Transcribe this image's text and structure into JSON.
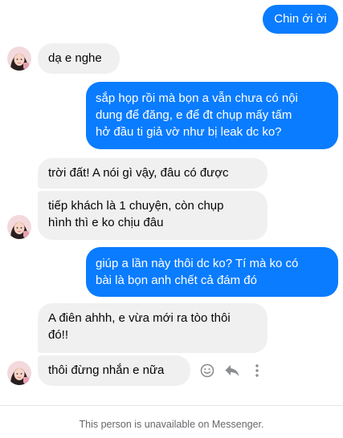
{
  "messages": [
    {
      "side": "out",
      "text": "Chin ới ời"
    },
    {
      "side": "in",
      "text": "dạ e nghe"
    },
    {
      "side": "out",
      "text": "sắp họp rồi mà bọn a vẫn chưa có nội\ndung để đăng, e để đt chụp mấy tấm\nhở đầu ti giả vờ như bị leak dc ko?"
    },
    {
      "side": "in",
      "text": "trời đất! A nói gì vậy, đâu có được"
    },
    {
      "side": "in",
      "text": "tiếp khách là 1 chuyện, còn chụp\nhình thì e ko chịu đâu"
    },
    {
      "side": "out",
      "text": "giúp a lần này thôi dc ko? Tí mà ko có\nbài là bọn anh chết cả đám đó"
    },
    {
      "side": "in",
      "text": "A điên ahhh, e vừa mới ra tòo thôi\nđó!!"
    },
    {
      "side": "in",
      "text": "thôi đừng nhắn e nữa"
    }
  ],
  "message_actions": {
    "icons": [
      "smile-icon",
      "reply-icon",
      "more-icon"
    ]
  },
  "footer": {
    "notice": "This person is unavailable on Messenger."
  },
  "colors": {
    "outgoing": "#0a7cff",
    "incoming": "#f0f0f0",
    "footer_text": "#65676b"
  }
}
